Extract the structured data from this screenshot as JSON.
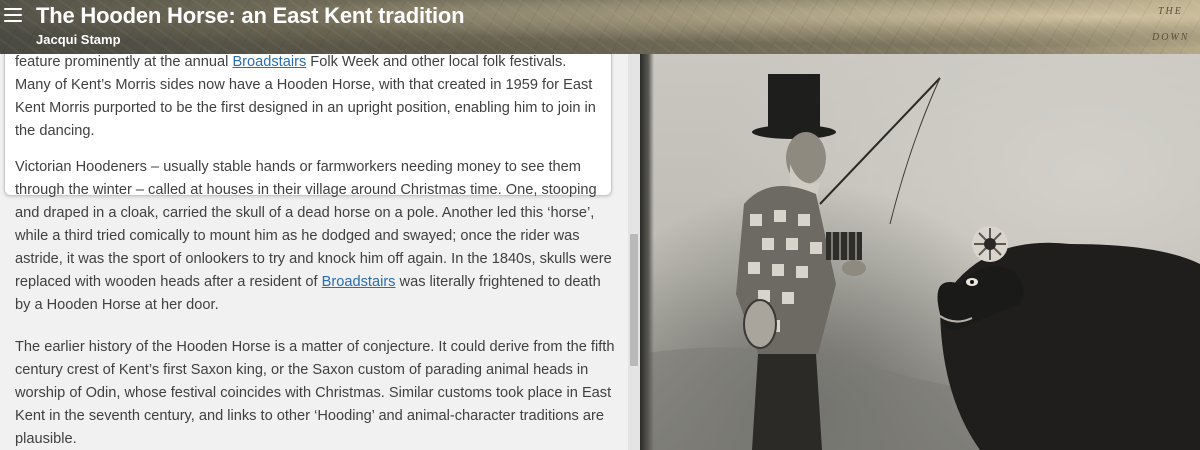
{
  "header": {
    "title": "The Hooden Horse: an East Kent tradition",
    "author": "Jacqui Stamp",
    "menu_icon": "hamburger-menu-icon",
    "map_words": [
      "THE",
      "DOWN"
    ]
  },
  "article": {
    "quote_box": {
      "line1_before": "feature prominently at the annual ",
      "line1_link": "Broadstairs",
      "line1_after": " Folk Week and other local folk festivals. Many",
      "rest": "of Kent’s Morris sides now have a Hooden Horse, with that created in 1959 for East Kent Morris purported to be the first designed in an upright position, enabling him to join in the dancing."
    },
    "para1": {
      "before": "Victorian Hoodeners – usually stable hands or farmworkers needing money to see them through the winter – called at houses in their village around Christmas time. One, stooping and draped in a cloak, carried the skull of a dead horse on a pole. Another led this ‘horse’, while a third tried comically to mount him as he dodged and swayed; once the rider was astride, it was the sport of onlookers to try and knock him off again. In the 1840s, skulls were replaced with wooden heads after a resident of ",
      "link": "Broadstairs",
      "after": " was literally frightened to death by a Hooden Horse at her door."
    },
    "para2": "The earlier history of the Hooden Horse is a matter of conjecture. It could derive from the fifth century crest of Kent’s first Saxon king, or the Saxon custom of parading animal heads in worship of Odin, whose festival coincides with Christmas. Similar customs took place in East Kent in the seventh century, and links to other ‘Hooding’ and animal-character traditions are plausible."
  },
  "colors": {
    "link": "#2a6db0",
    "text": "#404040",
    "panel_bg": "#f1f1f1"
  }
}
